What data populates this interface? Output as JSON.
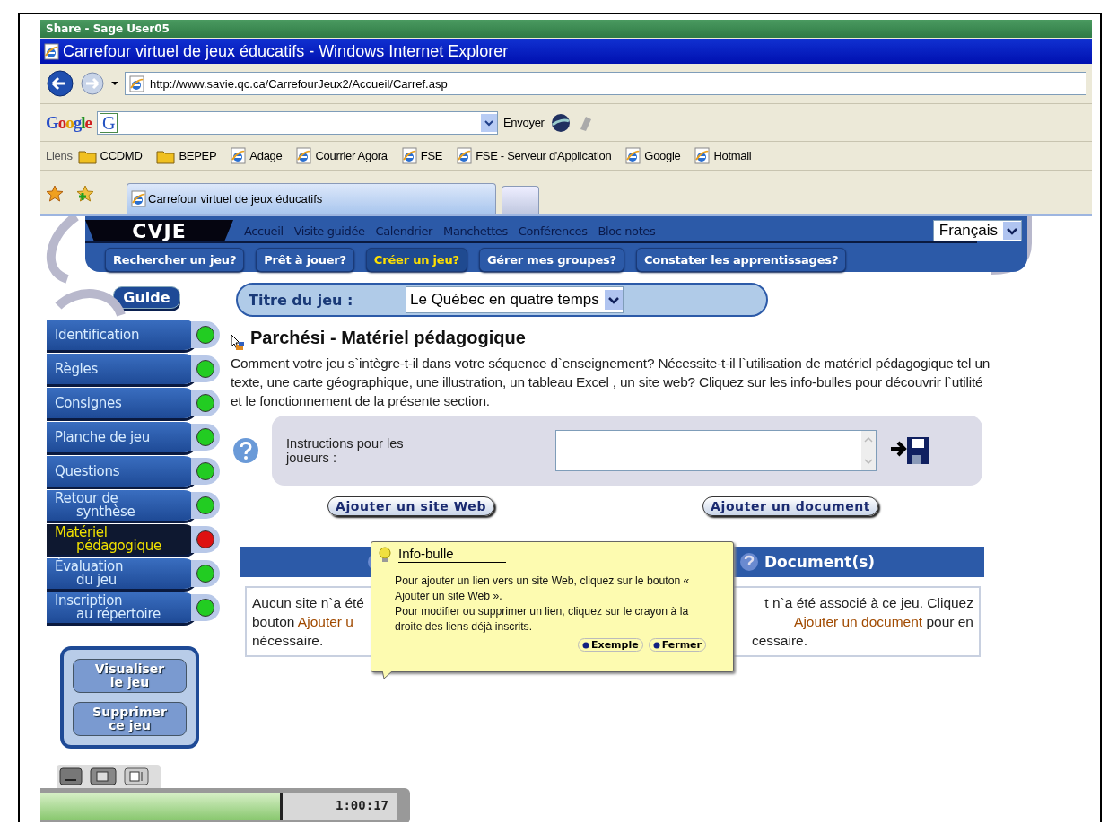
{
  "session": {
    "title": "Share - Sage User05",
    "time": "1:00:17",
    "level": 0.67
  },
  "browser": {
    "title": "Carrefour virtuel de jeux éducatifs - Windows Internet Explorer",
    "address": "http://www.savie.qc.ca/CarrefourJeux2/Accueil/Carref.asp",
    "google": {
      "logo": "Google",
      "g_button": "G",
      "send": "Envoyer"
    },
    "links_label": "Liens",
    "links": [
      {
        "label": "CCDMD",
        "kind": "folder"
      },
      {
        "label": "BEPEP",
        "kind": "folder"
      },
      {
        "label": "Adage",
        "kind": "page"
      },
      {
        "label": "Courrier Agora",
        "kind": "page"
      },
      {
        "label": "FSE",
        "kind": "page"
      },
      {
        "label": "FSE - Serveur d'Application",
        "kind": "page"
      },
      {
        "label": "Google",
        "kind": "page"
      },
      {
        "label": "Hotmail",
        "kind": "page"
      }
    ],
    "tabs": [
      {
        "label": "Carrefour virtuel de jeux éducatifs",
        "selected": true
      }
    ]
  },
  "site": {
    "logo": "CVJE",
    "nav": [
      "Accueil",
      "Visite guidée",
      "Calendrier",
      "Manchettes",
      "Conférences",
      "Bloc notes"
    ],
    "language": "Français",
    "main_tabs": [
      {
        "label": "Rechercher un jeu?",
        "selected": false
      },
      {
        "label": "Prêt à jouer?",
        "selected": false
      },
      {
        "label": "Créer un jeu?",
        "selected": true
      },
      {
        "label": "Gérer mes groupes?",
        "selected": false
      },
      {
        "label": "Constater les apprentissages?",
        "selected": false
      }
    ],
    "guide": "Guide",
    "sidebar": [
      {
        "lines": [
          "Identification"
        ],
        "selected": false,
        "color": "#22cc22"
      },
      {
        "lines": [
          "Règles"
        ],
        "selected": false,
        "color": "#22cc22"
      },
      {
        "lines": [
          "Consignes"
        ],
        "selected": false,
        "color": "#22cc22"
      },
      {
        "lines": [
          "Planche de jeu"
        ],
        "selected": false,
        "color": "#22cc22"
      },
      {
        "lines": [
          "Questions"
        ],
        "selected": false,
        "color": "#22cc22"
      },
      {
        "lines": [
          "Retour de",
          "synthèse"
        ],
        "selected": false,
        "color": "#22cc22"
      },
      {
        "lines": [
          "Matériel",
          "pédagogique"
        ],
        "selected": true,
        "color": "#dd1111"
      },
      {
        "lines": [
          "Évaluation",
          "du jeu"
        ],
        "selected": false,
        "color": "#22cc22"
      },
      {
        "lines": [
          "Inscription",
          "au répertoire"
        ],
        "selected": false,
        "color": "#22cc22"
      }
    ],
    "actions": [
      {
        "lines": [
          "Visualiser",
          "le jeu"
        ]
      },
      {
        "lines": [
          "Supprimer",
          "ce jeu"
        ]
      }
    ],
    "title_label": "Titre du jeu :",
    "title_value": "Le Québec en quatre temps",
    "heading": "Parchési - Matériel pédagogique",
    "intro": "Comment votre jeu s`intègre-t-il dans votre séquence d`enseignement? Nécessite-t-il l`utilisation de matériel pédagogique tel un texte, une carte géographique, une illustration, un tableau Excel , un site web? Cliquez sur les info-bulles pour découvrir l`utilité et le fonctionnement de la présente section.",
    "instructions_label": "Instructions pour les joueurs :",
    "add_buttons": [
      "Ajouter un site Web",
      "Ajouter un document"
    ],
    "panels": [
      {
        "lines": [
          {
            "before": "Aucun site n`a été"
          },
          {
            "before": "bouton",
            "link": "Ajouter u"
          },
          {
            "before": "nécessaire."
          }
        ]
      },
      {
        "title": "Document(s)",
        "lines": [
          {
            "before": "t n`a été associé à ce jeu. Cliquez"
          },
          {
            "link": "Ajouter un document",
            "after": "pour en"
          },
          {
            "before": "cessaire."
          }
        ]
      }
    ],
    "tooltip": {
      "title": "Info-bulle",
      "paragraphs": [
        "Pour ajouter un lien vers un site Web, cliquez sur le bouton « Ajouter un site Web ».",
        "Pour modifier ou supprimer un lien, cliquez sur le crayon à la droite des liens déjà inscrits."
      ],
      "buttons": [
        "Exemple",
        "Fermer"
      ]
    }
  }
}
